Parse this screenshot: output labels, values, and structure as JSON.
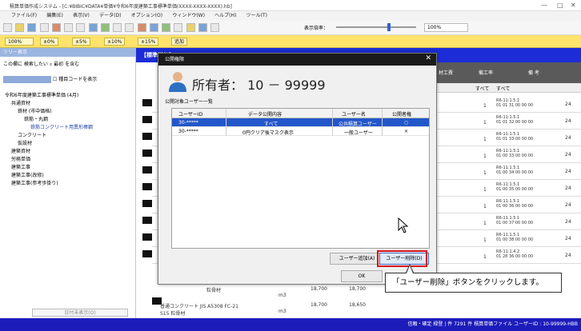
{
  "window": {
    "title": "積算単価作成システム - [C:¥BIBIC¥DATA¥単価¥令和6年度建築工事標準単価(XXXX-XXXX-XXXX).hb]",
    "controls": [
      "—",
      "□",
      "✕"
    ]
  },
  "menu": {
    "items": [
      "ファイル(F)",
      "編集(E)",
      "表示(V)",
      "データ(D)",
      "オプション(O)",
      "ウィンドウ(W)",
      "ヘルプ(H)",
      "ツール(T)"
    ]
  },
  "zoombar": {
    "zoom": "100%",
    "chips": [
      "±0%",
      "±5%",
      "±10%",
      "±15%",
      "追加"
    ],
    "display_label": "表示倍率：",
    "display_value": "100%"
  },
  "leftpanel": {
    "header": "ツリー表示",
    "search_placeholder": "この欄に 検索したい",
    "search_button": "最初",
    "search_next": "を含む",
    "checkbox_label": "種目コードを表示",
    "tree": [
      "令和6年度建築工事標準単価 (4月)",
      "共通資材",
      "鉄材 (市中価格)",
      "鉄筋・丸鋼",
      "鉄筋コンクリート用異形棒鋼",
      "コンクリート",
      "仮設材",
      "建築資材",
      "労務単価",
      "建築工事",
      "建築工事(改修)",
      "建築工事(参考歩掛り)"
    ],
    "bottom_button": "日付未表示(O)"
  },
  "main": {
    "header_title": "【標準単価】",
    "grid_headers": [
      "材工費",
      "備工率",
      "備 考"
    ],
    "filter_values": [
      "すべて",
      "すべて"
    ],
    "rows": [
      {
        "date1": "R6-11:1.5.1",
        "date2": "01 01 31 00 00 00",
        "num": "24"
      },
      {
        "date1": "R6-11:1.5.1",
        "date2": "01 01 32 00 00 00",
        "num": "24"
      },
      {
        "date1": "R6-11:1.5.1",
        "date2": "01 01 33 00 00 00",
        "num": "24"
      },
      {
        "date1": "R6-11:1.5.1",
        "date2": "01 00 33 00 00 00",
        "num": "24"
      },
      {
        "date1": "R6-11:1.5.1",
        "date2": "01 00 34 00 00 00",
        "num": "24"
      },
      {
        "date1": "R6-11:1.5.1",
        "date2": "01 00 35 00 00 00",
        "num": "24"
      },
      {
        "date1": "R6-11:1.5.1",
        "date2": "01 00 36 00 00 00",
        "num": "24"
      },
      {
        "date1": "R6-11:1.5.1",
        "date2": "01 00 37 00 00 00",
        "num": "24"
      },
      {
        "date1": "R6-11:1.5.1",
        "date2": "01 00 38 00 00 00",
        "num": "24"
      },
      {
        "date1": "R6-11:1.4.2",
        "date2": "01 28 36 00 00 00",
        "num": "24"
      }
    ],
    "bottom_rows": [
      {
        "name": "粒骨材",
        "qty": "18,700",
        "qty2": "18,700",
        "unit": "m3"
      },
      {
        "name": "普通コンクリート  JIS  A5308  FC-21  S15  粒骨材",
        "qty": "18,700",
        "qty2": "18,650",
        "unit": "m3"
      }
    ]
  },
  "statusbar": {
    "text": "信頼・確定 緑登 | 件  7291 件  積算単価ファイル  ユーザーID : 10-99999-HBB"
  },
  "dialog": {
    "title": "公開権限",
    "owner": "所有者：  10 － 99999",
    "section_label": "公開対象ユーザー一覧",
    "columns": [
      "ユーザーID",
      "データ公開内容",
      "ユーザー名",
      "公開者権"
    ],
    "rows": [
      {
        "id": "30-*****",
        "content": "すべて",
        "name": "公共積算ユーザー",
        "perm": "○",
        "selected": true
      },
      {
        "id": "30-*****",
        "content": "0円クリア後マスク表示",
        "name": "一般ユーザー",
        "perm": "×",
        "selected": false
      }
    ],
    "add_button": "ユーザー追加(A)",
    "delete_button": "ユーザー削除(D)",
    "ok_button": "OK"
  },
  "callout": {
    "text": "「ユーザー削除」ボタンをクリックします。"
  }
}
